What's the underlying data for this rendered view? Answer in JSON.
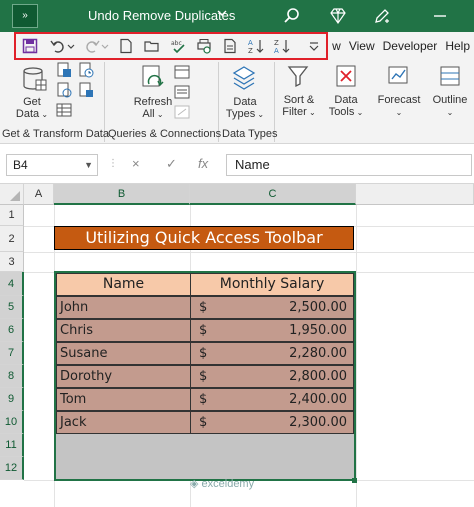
{
  "titlebar": {
    "expand_label": "»",
    "title": "Undo Remove Duplicates"
  },
  "tabs": [
    "w",
    "View",
    "Developer",
    "Help"
  ],
  "ribbon": {
    "get_data": "Get\nData",
    "refresh_all": "Refresh\nAll",
    "data_types": "Data\nTypes",
    "sort_filter": "Sort &\nFilter",
    "data_tools": "Data\nTools",
    "forecast": "Forecast",
    "outline": "Outline",
    "group_get_transform": "Get & Transform Data",
    "group_queries": "Queries & Connections",
    "group_data_types": "Data Types"
  },
  "formula_bar": {
    "name_box": "B4",
    "cancel": "×",
    "enter": "✓",
    "fx": "fx",
    "value": "Name"
  },
  "columns": [
    "A",
    "B",
    "C"
  ],
  "rows": [
    "1",
    "2",
    "3",
    "4",
    "5",
    "6",
    "7",
    "8",
    "9",
    "10",
    "11",
    "12"
  ],
  "sheet": {
    "title": "Utilizing Quick Access Toolbar",
    "headers": [
      "Name",
      "Monthly Salary"
    ],
    "records": [
      {
        "name": "John",
        "currency": "$",
        "salary": "2,500.00"
      },
      {
        "name": "Chris",
        "currency": "$",
        "salary": "1,950.00"
      },
      {
        "name": "Susane",
        "currency": "$",
        "salary": "2,280.00"
      },
      {
        "name": "Dorothy",
        "currency": "$",
        "salary": "2,800.00"
      },
      {
        "name": "Tom",
        "currency": "$",
        "salary": "2,400.00"
      },
      {
        "name": "Jack",
        "currency": "$",
        "salary": "2,300.00"
      }
    ]
  },
  "watermark": "exceldemy",
  "colors": {
    "excel_green": "#217346",
    "qat_border": "#e0202a",
    "title_fill": "#c55a11",
    "header_fill": "#f7c9a9",
    "row_fill": "#c39b8e"
  }
}
